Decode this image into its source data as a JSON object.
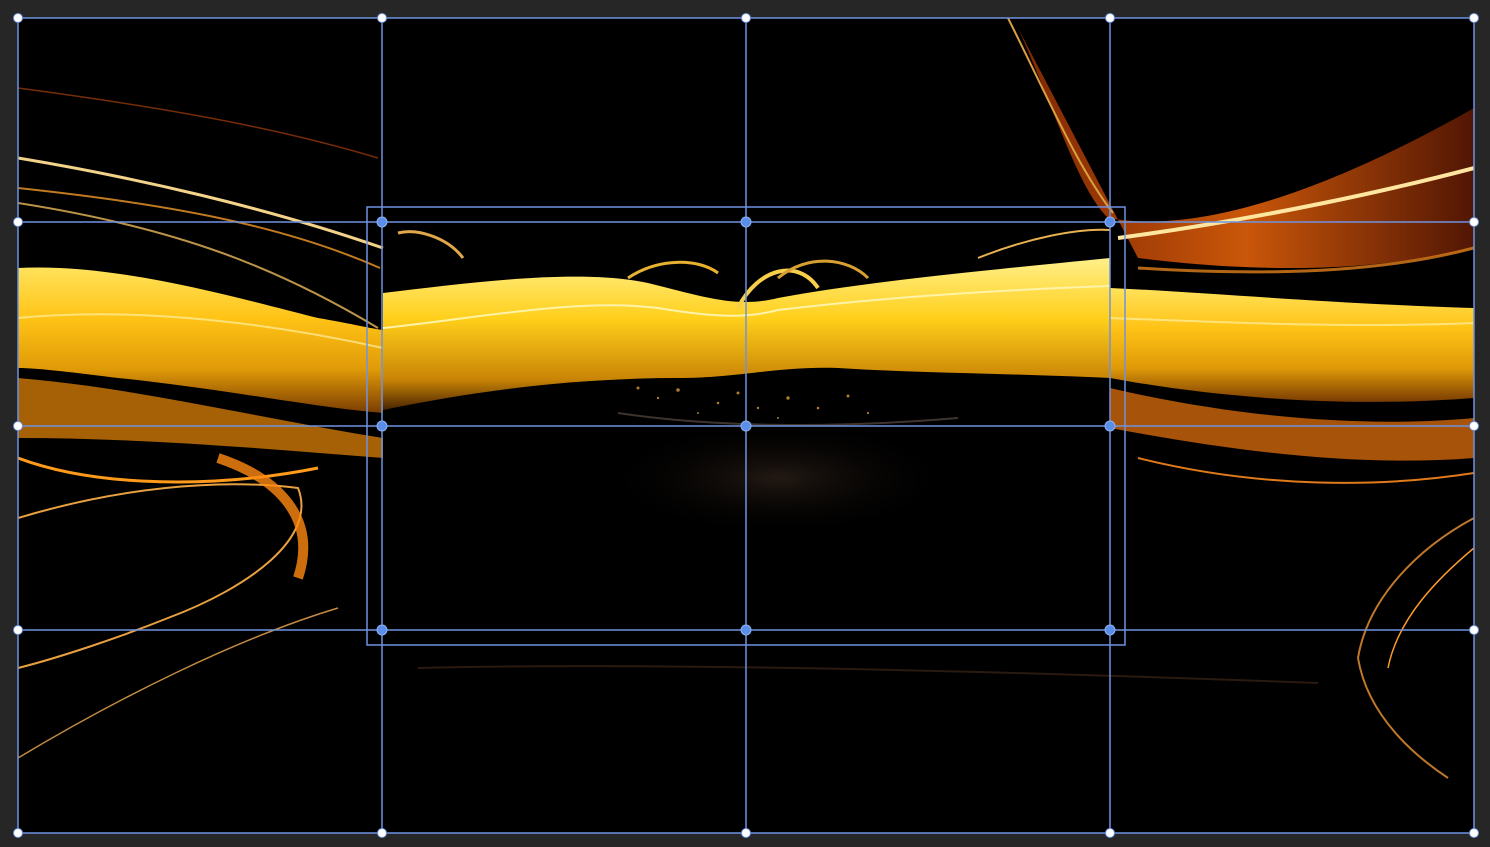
{
  "canvas": {
    "background_color": "#262626",
    "artwork_background": "#000000",
    "artwork_subject": "abstract-golden-liquid-swirl"
  },
  "overlay": {
    "guide_color": "#6f93e0",
    "handle_color": "#5b8ee8",
    "outer_grid": {
      "columns": 4,
      "rows": 4
    },
    "selection_box": {
      "columns": 2,
      "rows": 2
    }
  },
  "palette": {
    "gold_bright": "#ffd21a",
    "gold": "#f2b10a",
    "amber": "#d9830a",
    "orange": "#e06a0a",
    "deep_red": "#6a1a05",
    "highlight": "#fff2b0"
  }
}
